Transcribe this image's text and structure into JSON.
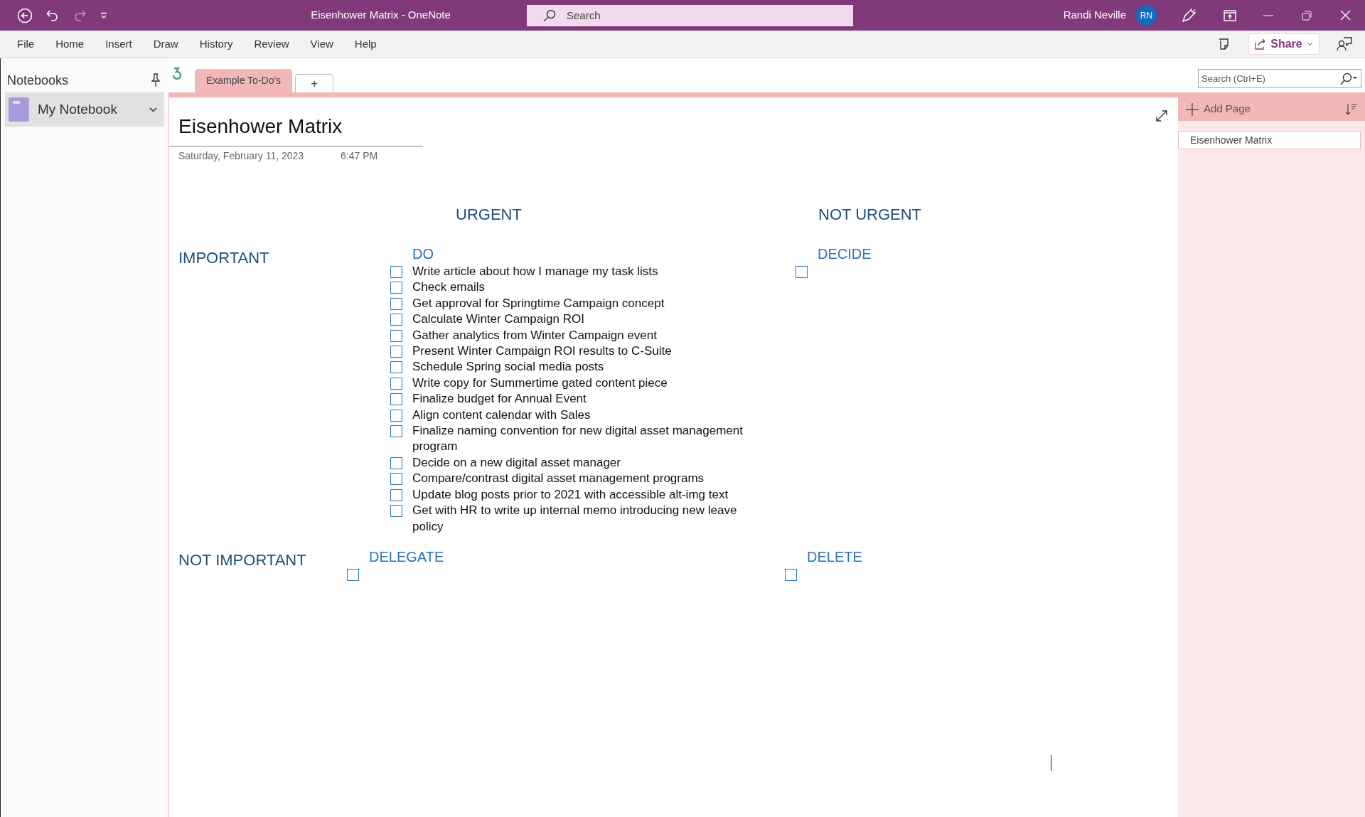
{
  "window": {
    "title": "Eisenhower Matrix  -  OneNote",
    "search": {
      "placeholder": "Search"
    },
    "user": "Randi Neville",
    "avatar_initials": "RN"
  },
  "menu": [
    {
      "label": "File"
    },
    {
      "label": "Home"
    },
    {
      "label": "Insert"
    },
    {
      "label": "Draw"
    },
    {
      "label": "History"
    },
    {
      "label": "Review"
    },
    {
      "label": "View"
    },
    {
      "label": "Help"
    }
  ],
  "share": "Share",
  "notebooks": {
    "title": "Notebooks",
    "items": [
      {
        "label": "My Notebook",
        "selected": true
      }
    ]
  },
  "sections": [
    {
      "label": "Example To-Do's",
      "selected": true
    },
    {
      "label": "+",
      "selected": false
    }
  ],
  "search_field": {
    "placeholder": "Search (Ctrl+E)"
  },
  "pages": {
    "add_label": "Add Page",
    "items": [
      {
        "label": "Eisenhower Matrix",
        "selected": true
      }
    ]
  },
  "note": {
    "title": "Eisenhower Matrix",
    "date": "Saturday, February 11, 2023",
    "time": "6:47 PM",
    "column_headings": [
      "URGENT",
      "NOT URGENT"
    ],
    "row_headings": [
      "IMPORTANT",
      "NOT IMPORTANT"
    ],
    "quadrants": [
      {
        "title": "DO",
        "items": [
          {
            "text": "Write article about how I manage my task lists",
            "checked": false
          },
          {
            "text": "Check emails",
            "checked": false
          },
          {
            "text": "Get approval for Springtime Campaign concept",
            "checked": false
          },
          {
            "text": "Calculate Winter Campaign ROI",
            "checked": false
          },
          {
            "text": "Gather analytics from Winter Campaign event",
            "checked": false
          },
          {
            "text": "Present Winter Campaign ROI results to C-Suite",
            "checked": false
          },
          {
            "text": "Schedule Spring social media posts",
            "checked": false
          },
          {
            "text": "Write copy for Summertime gated content piece",
            "checked": false
          },
          {
            "text": "Finalize budget for Annual Event",
            "checked": false
          },
          {
            "text": "Align content calendar with Sales",
            "checked": false
          },
          {
            "text": "Finalize naming convention for new digital asset management program",
            "checked": false
          },
          {
            "text": "Decide on a new digital asset manager",
            "checked": false
          },
          {
            "text": "Compare/contrast digital asset management programs",
            "checked": false
          },
          {
            "text": "Update blog posts prior to 2021 with accessible alt-img text",
            "checked": false
          },
          {
            "text": "Get with HR to write up internal memo introducing new leave policy",
            "checked": false
          }
        ]
      },
      {
        "title": "DECIDE",
        "items": [
          {
            "checked": false
          }
        ]
      },
      {
        "title": "DELEGATE",
        "items": [
          {
            "checked": false
          }
        ]
      },
      {
        "title": "DELETE",
        "items": [
          {
            "checked": false
          }
        ]
      }
    ]
  }
}
